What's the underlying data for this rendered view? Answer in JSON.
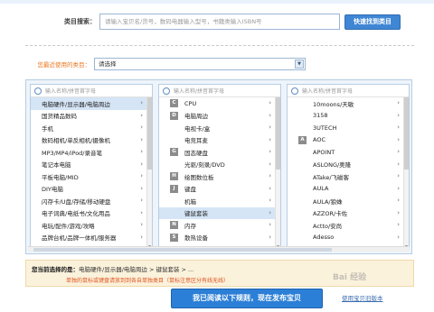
{
  "search": {
    "label": "类目搜索：",
    "placeholder": "请输入宝贝名/货号，数码电器输入型号，书籍类输入ISBN号",
    "button": "快速找到类目"
  },
  "recent": {
    "label": "您最近使用的类目：",
    "value": "请选择"
  },
  "columns": [
    {
      "search_placeholder": "输入名称/拼音首字母",
      "items": [
        {
          "label": "电脑硬件/显示器/电脑周边",
          "selected": true
        },
        {
          "label": "国货精品数码"
        },
        {
          "label": "手机"
        },
        {
          "label": "数码相机/单反相机/摄像机"
        },
        {
          "label": "MP3/MP4/iPod/录音笔"
        },
        {
          "label": "笔记本电脑"
        },
        {
          "label": "平板电脑/MID"
        },
        {
          "label": "DIY电脑"
        },
        {
          "label": "闪存卡/U盘/存储/移动硬盘"
        },
        {
          "label": "电子词典/电纸书/文化用品"
        },
        {
          "label": "电玩/配件/游戏/攻略"
        },
        {
          "label": "品牌台机/品牌一体机/服务器"
        }
      ]
    },
    {
      "search_placeholder": "输入名称/拼音首字母",
      "items": [
        {
          "letter": "C",
          "label": "CPU"
        },
        {
          "letter": "D",
          "label": "电脑周边"
        },
        {
          "letter": "",
          "label": "电视卡/盒"
        },
        {
          "letter": "",
          "label": "电竞耳麦"
        },
        {
          "letter": "G",
          "label": "固态硬盘"
        },
        {
          "letter": "",
          "label": "光驱/刻录/DVD"
        },
        {
          "letter": "H",
          "label": "绘图数位板"
        },
        {
          "letter": "J",
          "label": "键盘"
        },
        {
          "letter": "",
          "label": "机箱"
        },
        {
          "letter": "",
          "label": "键鼠套装",
          "selected": true
        },
        {
          "letter": "N",
          "label": "内存"
        },
        {
          "letter": "S",
          "label": "散热设备"
        }
      ]
    },
    {
      "search_placeholder": "输入名称/拼音首字母",
      "items": [
        {
          "letter": "",
          "label": "10moons/天敏"
        },
        {
          "letter": "",
          "label": "3158"
        },
        {
          "letter": "",
          "label": "3UTECH"
        },
        {
          "letter": "A",
          "label": "AOC"
        },
        {
          "letter": "",
          "label": "APOINT"
        },
        {
          "letter": "",
          "label": "ASLONG/奥隆"
        },
        {
          "letter": "",
          "label": "ATake/飞磁客"
        },
        {
          "letter": "",
          "label": "AULA"
        },
        {
          "letter": "",
          "label": "AULA/狼蛛"
        },
        {
          "letter": "",
          "label": "AZZOR/卡佐"
        },
        {
          "letter": "",
          "label": "Actto/安尚"
        },
        {
          "letter": "",
          "label": "Adesso"
        }
      ]
    }
  ],
  "chosen": {
    "label": "您当前选择的是：",
    "path": "电脑硬件/显示器/电脑周边 > 键鼠套装 > ...",
    "warning": "单独的鼠标或键盘请放到到各自单独类目（鼠标注意区分有线无线）"
  },
  "publish_button": "我已阅读以下规则，现在发布宝贝",
  "old_link": "使用宝贝旧版本",
  "watermark": "Bai 经验",
  "colors": {
    "accent": "#2c7fd6",
    "selected_row": "#d5e5f6",
    "warning": "#e0531c",
    "recent_label": "#e8761c"
  }
}
